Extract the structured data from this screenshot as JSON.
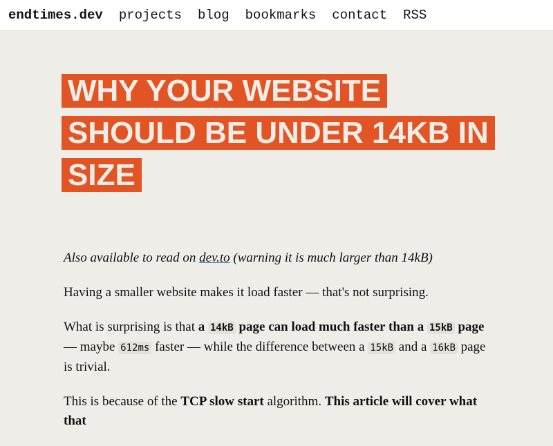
{
  "nav": {
    "brand": "endtimes.dev",
    "items": [
      "projects",
      "blog",
      "bookmarks",
      "contact",
      "RSS"
    ]
  },
  "title": "WHY YOUR WEBSITE SHOULD BE UNDER 14KB IN SIZE",
  "colors": {
    "accent": "#e25424",
    "background": "#eeede8"
  },
  "intro": {
    "prefix": "Also available to read on ",
    "link": "dev.to",
    "suffix": " (warning it is much larger than 14kB)"
  },
  "p1": "Having a smaller website makes it load faster — that's not surprising.",
  "p2": {
    "t1": "What is surprising is that ",
    "b1": "a ",
    "c1": "14kB",
    "b2": " page can load much faster than a ",
    "c2": "15kB",
    "b3": " page",
    "t2": " — maybe ",
    "c3": "612ms",
    "t3": " faster — while the difference between a ",
    "c4": "15kB",
    "t4": " and a ",
    "c5": "16kB",
    "t5": " page is trivial."
  },
  "p3": {
    "t1": "This is because of the ",
    "b1": "TCP slow start",
    "t2": " algorithm. ",
    "b2": "This article will cover what that"
  }
}
